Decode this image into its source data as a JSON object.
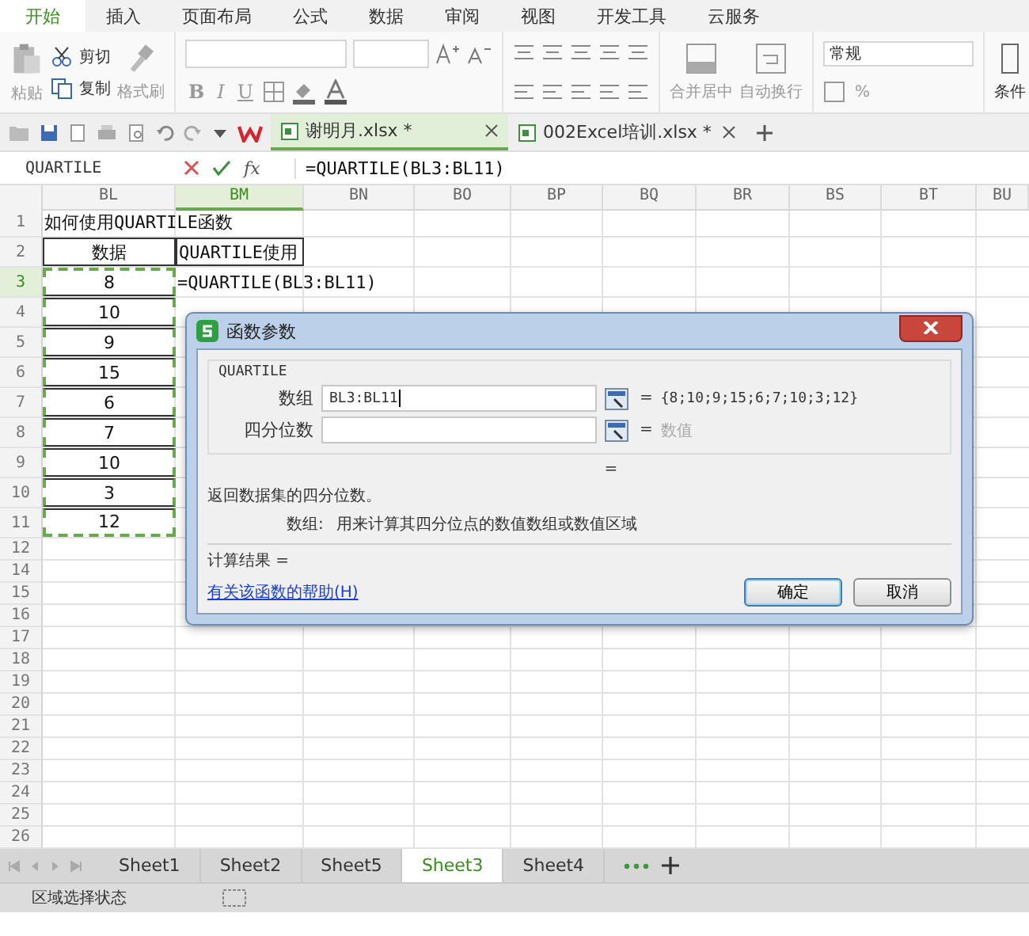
{
  "menu_tabs": [
    {
      "label": "开始",
      "selected": true
    },
    {
      "label": "插入",
      "selected": false
    },
    {
      "label": "页面布局",
      "selected": false
    },
    {
      "label": "公式",
      "selected": false
    },
    {
      "label": "数据",
      "selected": false
    },
    {
      "label": "审阅",
      "selected": false
    },
    {
      "label": "视图",
      "selected": false
    },
    {
      "label": "开发工具",
      "selected": false
    },
    {
      "label": "云服务",
      "selected": false
    }
  ],
  "ribbon": {
    "paste": "粘贴",
    "cut": "剪切",
    "copy": "复制",
    "format_painter": "格式刷",
    "bold": "B",
    "italic": "I",
    "underline": "U",
    "merge": "合并居中",
    "wrap": "自动换行",
    "number_format": "常规",
    "percent": "%",
    "conditional": "条件"
  },
  "doc_tabs": [
    {
      "label": "谢明月.xlsx *",
      "selected": true
    },
    {
      "label": "002Excel培训.xlsx *",
      "selected": false
    }
  ],
  "formula_bar": {
    "name_box": "QUARTILE",
    "fx": "fx",
    "formula": "=QUARTILE(BL3:BL11)"
  },
  "sheet": {
    "columns": [
      {
        "label": "BL",
        "selected": false
      },
      {
        "label": "BM",
        "selected": true
      },
      {
        "label": "BN",
        "selected": false
      },
      {
        "label": "BO",
        "selected": false
      },
      {
        "label": "BP",
        "selected": false
      },
      {
        "label": "BQ",
        "selected": false
      },
      {
        "label": "BR",
        "selected": false
      },
      {
        "label": "BS",
        "selected": false
      },
      {
        "label": "BT",
        "selected": false
      },
      {
        "label": "BU",
        "selected": false
      }
    ],
    "rows": [
      {
        "number": "1",
        "selected": false,
        "in_range": false,
        "cells": [
          {
            "text": "如何使用QUARTILE函数",
            "boxed": false
          }
        ]
      },
      {
        "number": "2",
        "selected": false,
        "in_range": false,
        "cells": [
          {
            "text": "数据",
            "boxed": true
          },
          {
            "text": "QUARTILE使用",
            "boxed": true
          }
        ]
      },
      {
        "number": "3",
        "selected": true,
        "in_range": true,
        "cells": [
          {
            "text": "8",
            "boxed": true
          },
          {
            "text": "=QUARTILE(BL3:BL11)",
            "boxed": false
          }
        ]
      },
      {
        "number": "4",
        "selected": false,
        "in_range": true,
        "cells": [
          {
            "text": "10",
            "boxed": true
          }
        ]
      },
      {
        "number": "5",
        "selected": false,
        "in_range": true,
        "cells": [
          {
            "text": "9",
            "boxed": true
          }
        ]
      },
      {
        "number": "6",
        "selected": false,
        "in_range": true,
        "cells": [
          {
            "text": "15",
            "boxed": true
          }
        ]
      },
      {
        "number": "7",
        "selected": false,
        "in_range": true,
        "cells": [
          {
            "text": "6",
            "boxed": true
          }
        ]
      },
      {
        "number": "8",
        "selected": false,
        "in_range": true,
        "cells": [
          {
            "text": "7",
            "boxed": true
          }
        ]
      },
      {
        "number": "9",
        "selected": false,
        "in_range": true,
        "cells": [
          {
            "text": "10",
            "boxed": true
          }
        ]
      },
      {
        "number": "10",
        "selected": false,
        "in_range": true,
        "cells": [
          {
            "text": "3",
            "boxed": true
          }
        ]
      },
      {
        "number": "11",
        "selected": false,
        "in_range": true,
        "cells": [
          {
            "text": "12",
            "boxed": true
          }
        ]
      }
    ],
    "empty_rows": [
      "12",
      "14",
      "15",
      "16",
      "17",
      "18",
      "19",
      "20",
      "21",
      "22",
      "23",
      "24",
      "25",
      "26"
    ]
  },
  "dialog": {
    "title": "函数参数",
    "function_name": "QUARTILE",
    "args": [
      {
        "label": "数组",
        "value": "BL3:BL11",
        "equals": "=",
        "result": "{8;10;9;15;6;7;10;3;12}",
        "muted": false
      },
      {
        "label": "四分位数",
        "equals": "=",
        "result": "数值",
        "muted": true
      }
    ],
    "formula_result": "=",
    "description": "返回数据集的四分位数。",
    "arg_help_label": "数组:",
    "arg_help": "用来计算其四分位点的数值数组或数值区域",
    "calc_result": "计算结果 =",
    "help_link": "有关该函数的帮助(H)",
    "buttons": [
      {
        "label": "确定",
        "default": true
      },
      {
        "label": "取消",
        "default": false
      }
    ]
  },
  "sheet_tabs": [
    {
      "label": "Sheet1",
      "selected": false
    },
    {
      "label": "Sheet2",
      "selected": false
    },
    {
      "label": "Sheet5",
      "selected": false
    },
    {
      "label": "Sheet3",
      "selected": true
    },
    {
      "label": "Sheet4",
      "selected": false
    }
  ],
  "status_bar": "区域选择状态"
}
